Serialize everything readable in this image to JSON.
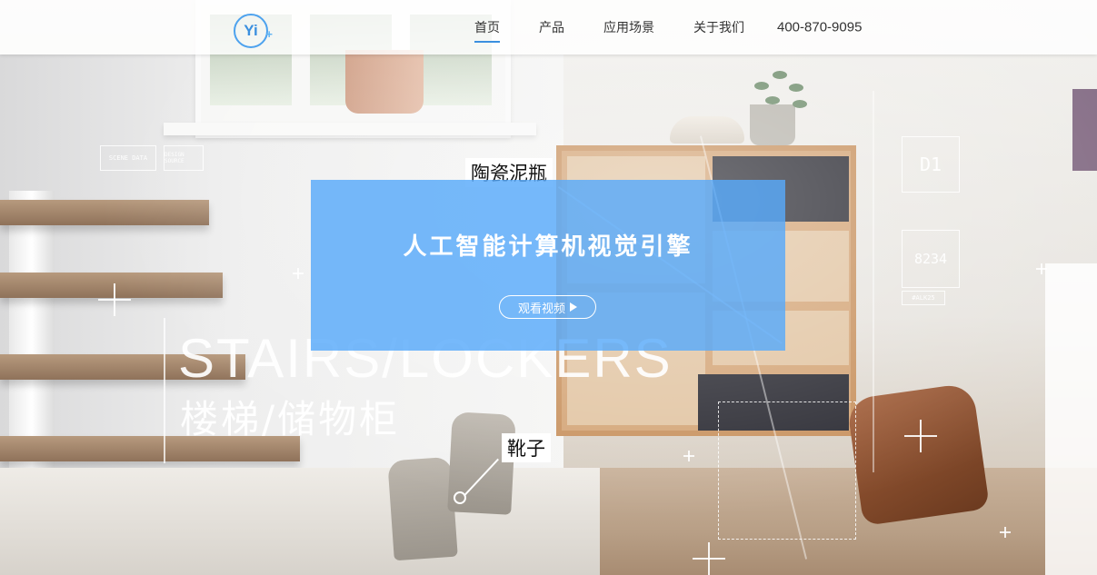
{
  "header": {
    "logo_text": "Yi",
    "logo_plus": "+",
    "nav": [
      {
        "label": "首页",
        "active": true
      },
      {
        "label": "产品",
        "active": false
      },
      {
        "label": "应用场景",
        "active": false
      },
      {
        "label": "关于我们",
        "active": false
      }
    ],
    "phone": "400-870-9095"
  },
  "hero": {
    "title": "人工智能计算机视觉引擎",
    "button_label": "观看视频",
    "button_icon": "play-triangle-icon"
  },
  "scene": {
    "title_en": "STAIRS/LOCKERS",
    "title_zh": "楼梯/储物柜",
    "tag_vase": "陶瓷泥瓶",
    "tag_shoes": "靴子",
    "hud_box_1": "D1",
    "hud_box_2": "8234",
    "hud_tag_1": "#ALK25",
    "hud_label_left_1": "SCENE  DATA",
    "hud_label_left_2": "DESIGN  SOURCE"
  },
  "colors": {
    "accent": "#3a8fdf",
    "hero_bg": "#58aafa"
  }
}
